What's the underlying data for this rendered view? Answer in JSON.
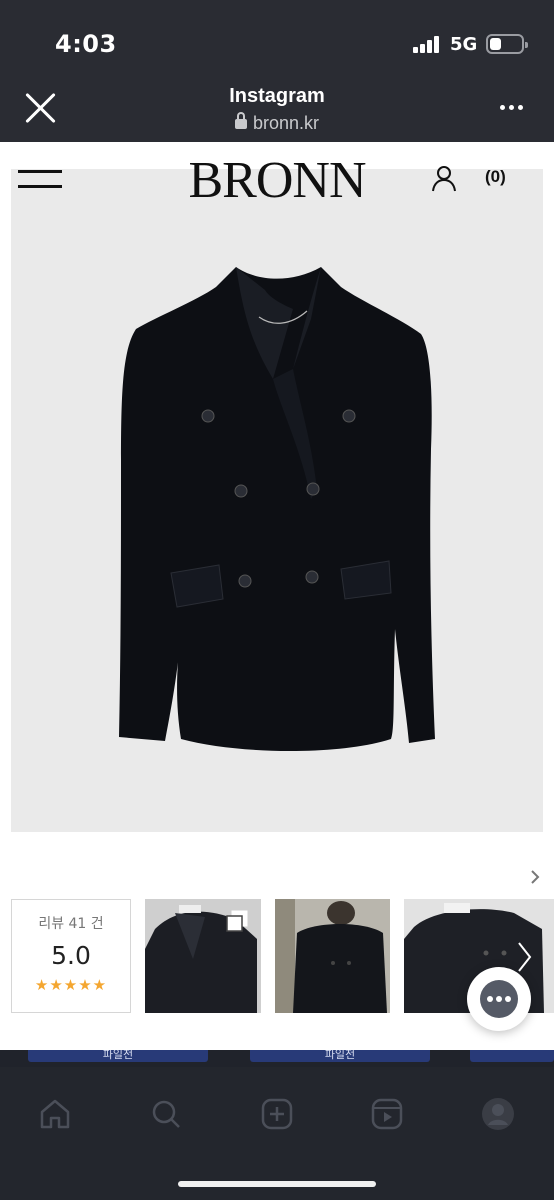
{
  "status_bar": {
    "time": "4:03",
    "network": "5G",
    "battery_level": 0.35
  },
  "browser": {
    "title": "Instagram",
    "url": "bronn.kr",
    "icons": [
      "close-icon",
      "lock-icon",
      "more-icon"
    ]
  },
  "site": {
    "brand": "BRONN",
    "cart_count": "(0)",
    "icons": [
      "menu-icon",
      "user-icon"
    ]
  },
  "product": {
    "image_description_icon": "jacket-image"
  },
  "reviews": {
    "count_label": "리뷰 41 건",
    "score": "5.0",
    "stars": "★★★★★",
    "star_rating": 5,
    "star_color": "#f4a630"
  },
  "bottom_strip": {
    "items": [
      "파일전",
      "파일전"
    ]
  },
  "tab_bar": {
    "icons": [
      "home-icon",
      "search-icon",
      "create-icon",
      "reels-icon",
      "profile-icon"
    ]
  },
  "colors": {
    "chrome_bg": "#2a2c33",
    "page_bg": "#ffffff",
    "image_bg": "#eaeaea",
    "accent_stars": "#f4a630",
    "chat_button": "#555a66"
  }
}
